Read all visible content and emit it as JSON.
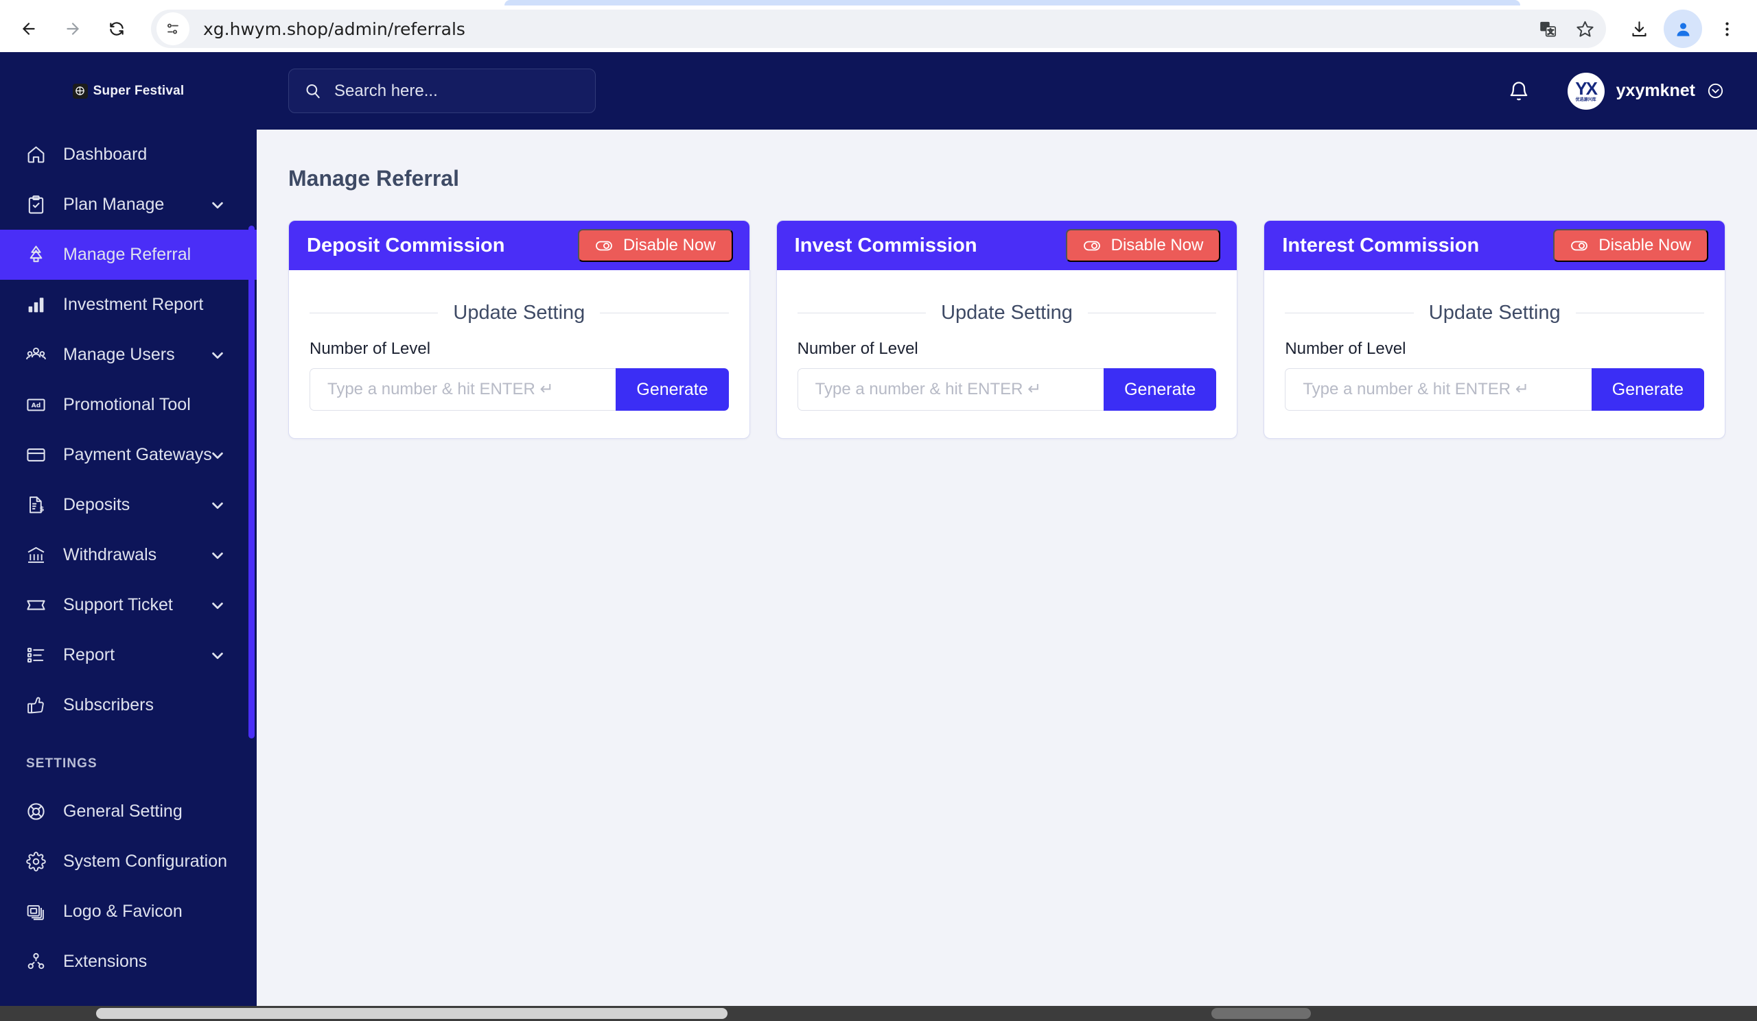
{
  "browser": {
    "url": "xg.hwym.shop/admin/referrals",
    "back_label": "Back",
    "forward_label": "Forward",
    "reload_label": "Reload",
    "site_info_label": "View site information",
    "translate_label": "Translate this page",
    "bookmark_label": "Bookmark this tab",
    "download_label": "Downloads",
    "profile_label": "Profile",
    "menu_label": "Customize and control Google Chrome"
  },
  "sidebar": {
    "brand": "Super Festival",
    "items": [
      {
        "label": "Dashboard",
        "icon": "home-icon",
        "caret": false,
        "active": false
      },
      {
        "label": "Plan Manage",
        "icon": "clipboard-check-icon",
        "caret": true,
        "active": false
      },
      {
        "label": "Manage Referral",
        "icon": "tree-icon",
        "caret": false,
        "active": true
      },
      {
        "label": "Investment Report",
        "icon": "bar-chart-icon",
        "caret": false,
        "active": false
      },
      {
        "label": "Manage Users",
        "icon": "users-icon",
        "caret": true,
        "active": false
      },
      {
        "label": "Promotional Tool",
        "icon": "ad-icon",
        "caret": false,
        "active": false
      },
      {
        "label": "Payment Gateways",
        "icon": "credit-card-icon",
        "caret": true,
        "active": false
      },
      {
        "label": "Deposits",
        "icon": "file-dollar-icon",
        "caret": true,
        "active": false
      },
      {
        "label": "Withdrawals",
        "icon": "bank-icon",
        "caret": true,
        "active": false
      },
      {
        "label": "Support Ticket",
        "icon": "ticket-icon",
        "caret": true,
        "active": false
      },
      {
        "label": "Report",
        "icon": "list-icon",
        "caret": true,
        "active": false
      },
      {
        "label": "Subscribers",
        "icon": "thumbs-up-icon",
        "caret": false,
        "active": false
      }
    ],
    "settings_heading": "SETTINGS",
    "settings_items": [
      {
        "label": "General Setting",
        "icon": "lifebuoy-icon",
        "caret": false
      },
      {
        "label": "System Configuration",
        "icon": "gear-icon",
        "caret": false
      },
      {
        "label": "Logo & Favicon",
        "icon": "images-icon",
        "caret": false
      },
      {
        "label": "Extensions",
        "icon": "extensions-icon",
        "caret": false
      }
    ]
  },
  "topbar": {
    "search_placeholder": "Search here...",
    "notification_label": "Notifications",
    "avatar_mark": "YX",
    "avatar_sub": "优选源兴库",
    "user_name": "yxymknet"
  },
  "main": {
    "page_title": "Manage Referral",
    "cards": [
      {
        "title": "Deposit Commission",
        "toggle_label": "Disable Now",
        "section_title": "Update Setting",
        "field_label": "Number of Level",
        "input_value": "",
        "input_placeholder": "Type a number & hit ENTER ↵",
        "button_label": "Generate"
      },
      {
        "title": "Invest Commission",
        "toggle_label": "Disable Now",
        "section_title": "Update Setting",
        "field_label": "Number of Level",
        "input_value": "",
        "input_placeholder": "Type a number & hit ENTER ↵",
        "button_label": "Generate"
      },
      {
        "title": "Interest Commission",
        "toggle_label": "Disable Now",
        "section_title": "Update Setting",
        "field_label": "Number of Level",
        "input_value": "",
        "input_placeholder": "Type a number & hit ENTER ↵",
        "button_label": "Generate"
      }
    ]
  },
  "colors": {
    "sidebar_bg": "#0d1559",
    "accent": "#4a2ef7",
    "generate": "#3b2ef5",
    "danger": "#ec5b58",
    "page_bg": "#f2f3f9"
  }
}
